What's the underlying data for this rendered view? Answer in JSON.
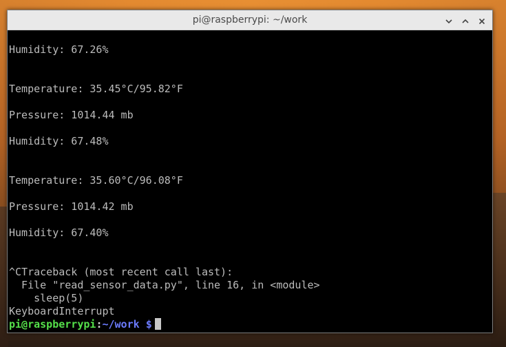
{
  "window": {
    "title": "pi@raspberrypi: ~/work",
    "controls": {
      "minimize_icon": "chevron-down-icon",
      "maximize_icon": "chevron-up-icon",
      "close_icon": "close-icon"
    }
  },
  "terminal": {
    "lines": [
      "Humidity: 67.26%",
      "Temperature: 35.45°C/95.82°F",
      "Pressure: 1014.44 mb",
      "Humidity: 67.48%",
      "Temperature: 35.60°C/96.08°F",
      "Pressure: 1014.42 mb",
      "Humidity: 67.40%",
      "^CTraceback (most recent call last):",
      "  File \"read_sensor_data.py\", line 16, in <module>",
      "    sleep(5)",
      "KeyboardInterrupt"
    ],
    "prompt": {
      "user_host": "pi@raspberrypi",
      "colon": ":",
      "path": "~/work",
      "symbol": "$"
    }
  },
  "colors": {
    "terminal_bg": "#000000",
    "terminal_text": "#bcbcbc",
    "prompt_user": "#55e04a",
    "prompt_path": "#6c7cff",
    "titlebar_bg": "#e9e9e9"
  }
}
